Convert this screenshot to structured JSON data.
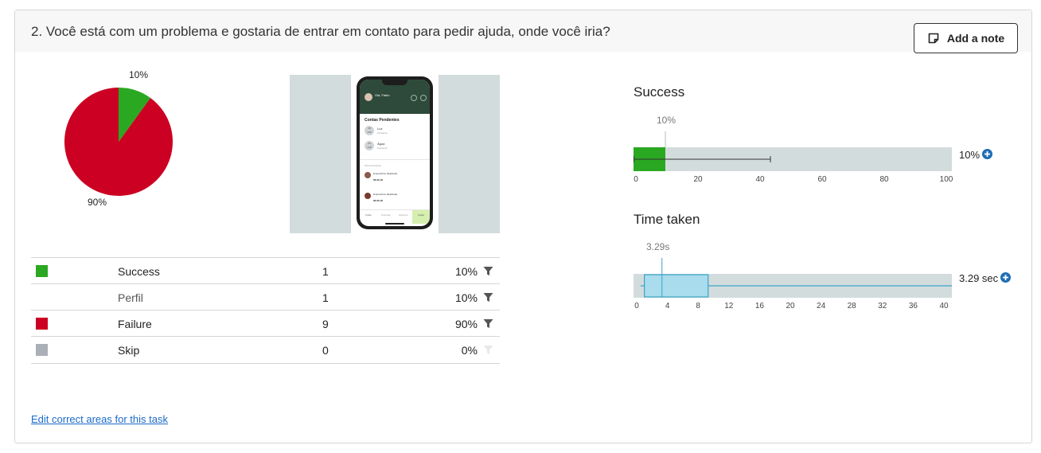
{
  "question": "2. Você está com um problema e gostaria de entrar em contato para pedir ajuda, onde você iria?",
  "add_note_label": "Add a note",
  "pie": {
    "label_success": "10%",
    "label_failure": "90%",
    "success_fraction": 0.1,
    "colors": {
      "success": "#2aa822",
      "failure": "#cc0022"
    }
  },
  "table": {
    "rows": [
      {
        "label": "Success",
        "count": "1",
        "pct": "10%",
        "swatch": "#2aa822"
      },
      {
        "label": "Perfil",
        "count": "1",
        "pct": "10%",
        "swatch": ""
      },
      {
        "label": "Failure",
        "count": "9",
        "pct": "90%",
        "swatch": "#cc0022"
      },
      {
        "label": "Skip",
        "count": "0",
        "pct": "0%",
        "swatch": "#aab0b6"
      }
    ]
  },
  "success_chart": {
    "title": "Success",
    "marker_label": "10%",
    "value_label": "10%",
    "ticks": [
      "0",
      "20",
      "40",
      "60",
      "80",
      "100"
    ]
  },
  "time_chart": {
    "title": "Time taken",
    "marker_label": "3.29s",
    "value_label": "3.29 sec",
    "ticks": [
      "0",
      "4",
      "8",
      "12",
      "16",
      "20",
      "24",
      "28",
      "32",
      "36",
      "40"
    ]
  },
  "phone_mock": {
    "user_name": "Olá, Fabio",
    "section_title": "Contas Pendentes",
    "bill_1_day": "28",
    "bill_1_month": "JUN",
    "bill_1_name": "Luz",
    "bill_1_status": "Pendente",
    "bill_2_day": "29",
    "bill_2_month": "JUN",
    "bill_2_name": "Água",
    "bill_2_status": "Pendente",
    "notifications_label": "Movimentações",
    "notif_1_title": "Empréstimo Realizado",
    "notif_1_amount": "R$ 80,00",
    "notif_2_title": "Empréstimo Realizado",
    "notif_2_amount": "R$ 80,00",
    "nav_labels": [
      "Início",
      "Pessoas",
      "Histórico",
      "Ajuda"
    ]
  },
  "chart_data": [
    {
      "type": "pie",
      "categories": [
        "Success",
        "Failure"
      ],
      "values": [
        10,
        90
      ],
      "labels": [
        "10%",
        "90%"
      ]
    },
    {
      "type": "bar",
      "title": "Success",
      "categories": [
        "Success"
      ],
      "values": [
        10
      ],
      "error_range": [
        0,
        43
      ],
      "xlim": [
        0,
        100
      ],
      "ticks": [
        0,
        20,
        40,
        60,
        80,
        100
      ]
    },
    {
      "type": "boxplot",
      "title": "Time taken",
      "median": 3.29,
      "q1": 1.0,
      "q3": 9.3,
      "whisker_low": 0.5,
      "whisker_high": 40,
      "xlim": [
        0,
        40
      ],
      "ticks": [
        0,
        4,
        8,
        12,
        16,
        20,
        24,
        28,
        32,
        36,
        40
      ]
    }
  ]
}
